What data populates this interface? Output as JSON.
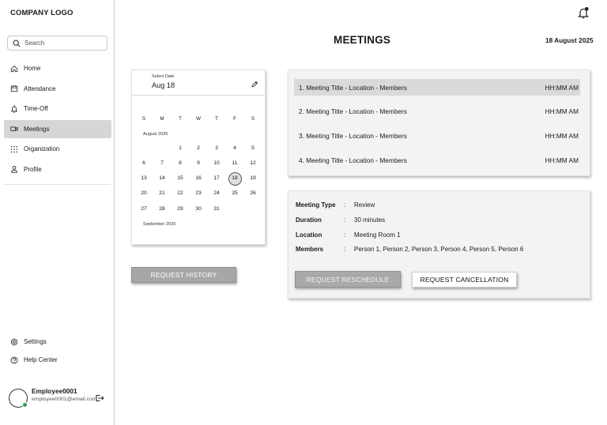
{
  "app": {
    "logo_text": "COMPANY LOGO"
  },
  "search": {
    "placeholder": "Search"
  },
  "sidebar": {
    "items": [
      {
        "label": "Home",
        "icon": "home-icon"
      },
      {
        "label": "Attendance",
        "icon": "calendar-icon"
      },
      {
        "label": "Time-Off",
        "icon": "bell-off-icon"
      },
      {
        "label": "Meetings",
        "icon": "video-icon",
        "active": true
      },
      {
        "label": "Organization",
        "icon": "grid-icon"
      },
      {
        "label": "Profile",
        "icon": "user-icon"
      }
    ],
    "bottom_items": [
      {
        "label": "Settings",
        "icon": "gear-icon"
      },
      {
        "label": "Help Center",
        "icon": "help-icon"
      }
    ]
  },
  "user": {
    "name": "Employee0001",
    "email": "employee0001@email.com",
    "status_color": "#2e9e4e"
  },
  "header": {
    "title": "MEETINGS",
    "date": "18 August 2025"
  },
  "calendar": {
    "select_label": "Select Date",
    "selected_value": "Aug 18",
    "weekdays": [
      "S",
      "M",
      "T",
      "W",
      "T",
      "F",
      "S"
    ],
    "month_label": "August 2025",
    "next_month_label": "September 2025",
    "days": [
      "1",
      "2",
      "3",
      "4",
      "5",
      "6",
      "7",
      "8",
      "9",
      "10",
      "11",
      "12",
      "13",
      "14",
      "15",
      "16",
      "17",
      "18",
      "19",
      "20",
      "21",
      "22",
      "23",
      "24",
      "25",
      "26",
      "27",
      "28",
      "29",
      "30",
      "31"
    ],
    "selected_day": "18"
  },
  "buttons": {
    "history": "REQUEST HISTORY",
    "reschedule": "REQUEST RESCHEDULE",
    "cancel": "REQUEST CANCELLATION"
  },
  "meetings": [
    {
      "title": "1. Meeting Title - Location - Members",
      "time": "HH:MM AM",
      "active": true
    },
    {
      "title": "2. Meeting Title - Location - Members",
      "time": "HH:MM AM"
    },
    {
      "title": "3. Meeting Title - Location - Members",
      "time": "HH:MM AM"
    },
    {
      "title": "4. Meeting Title - Location - Members",
      "time": "HH:MM AM"
    }
  ],
  "details": {
    "rows": [
      {
        "label": "Meeting Type",
        "value": "Review"
      },
      {
        "label": "Duration",
        "value": "30 minutes"
      },
      {
        "label": "Location",
        "value": "Meeting Room 1"
      },
      {
        "label": "Members",
        "value": "Person 1, Person 2, Person 3, Person 4, Person 5, Person 6"
      }
    ],
    "separator": ":"
  }
}
